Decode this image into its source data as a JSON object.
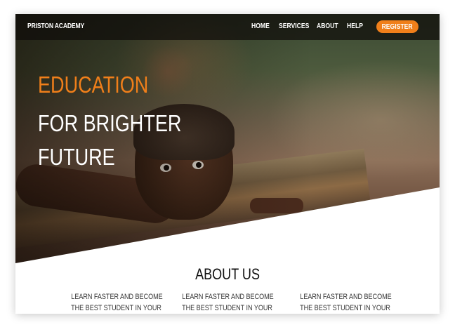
{
  "nav": {
    "brand": "PRISTON ACADEMY",
    "links": [
      "HOME",
      "SERVICES",
      "ABOUT",
      "HELP"
    ],
    "register_label": "REGISTER"
  },
  "hero": {
    "line1": "EDUCATION",
    "line2": "FOR BRIGHTER",
    "line3": "FUTURE"
  },
  "about": {
    "title": "ABOUT US",
    "columns": [
      {
        "line1": "LEARN FASTER AND BECOME",
        "line2": "THE BEST STUDENT IN YOUR"
      },
      {
        "line1": "LEARN FASTER AND BECOME",
        "line2": "THE BEST STUDENT IN YOUR"
      },
      {
        "line1": "LEARN FASTER AND BECOME",
        "line2": "THE BEST STUDENT IN YOUR"
      }
    ]
  },
  "colors": {
    "accent": "#f07f1a",
    "nav_bg": "#0f0c0a",
    "text_dark": "#111111"
  }
}
